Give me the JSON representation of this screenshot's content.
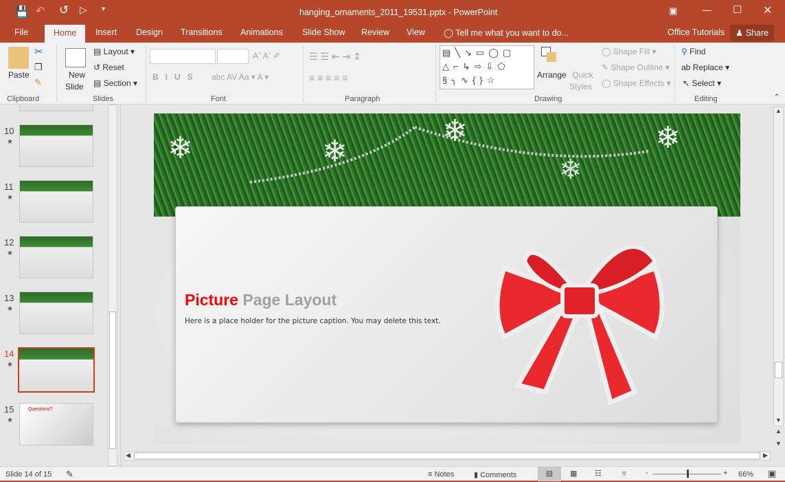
{
  "window": {
    "title": "hanging_ornaments_2011_19531.pptx - PowerPoint"
  },
  "tabs": [
    "File",
    "Home",
    "Insert",
    "Design",
    "Transitions",
    "Animations",
    "Slide Show",
    "Review",
    "View"
  ],
  "tell_me": "Tell me what you want to do...",
  "account": "Office Tutorials",
  "share": "Share",
  "ribbon": {
    "clipboard": {
      "paste": "Paste",
      "label": "Clipboard"
    },
    "slides": {
      "new_slide_1": "New",
      "new_slide_2": "Slide",
      "layout": "Layout",
      "reset": "Reset",
      "section": "Section",
      "label": "Slides"
    },
    "font": {
      "label": "Font",
      "name_value": "",
      "size_value": ""
    },
    "paragraph": {
      "label": "Paragraph"
    },
    "drawing": {
      "arrange": "Arrange",
      "quick_1": "Quick",
      "quick_2": "Styles",
      "shape_fill": "Shape Fill",
      "shape_outline": "Shape Outline",
      "shape_effects": "Shape Effects",
      "label": "Drawing"
    },
    "editing": {
      "find": "Find",
      "replace": "Replace",
      "select": "Select",
      "label": "Editing"
    }
  },
  "thumbnails": [
    {
      "num": "10"
    },
    {
      "num": "11"
    },
    {
      "num": "12"
    },
    {
      "num": "13"
    },
    {
      "num": "14",
      "selected": true
    },
    {
      "num": "15",
      "title": "Questions?"
    }
  ],
  "slide": {
    "title_red": "Picture",
    "title_gray": "Page Layout",
    "caption": "Here is a place holder for the picture caption.  You may delete this text."
  },
  "status": {
    "slide_info": "Slide 14 of 15",
    "notes": "Notes",
    "comments": "Comments",
    "zoom": "66%",
    "zoom_level": 66
  },
  "colors": {
    "accent": "#b7472a",
    "title_red": "#ff0000",
    "title_gray": "#a0a0a0"
  }
}
